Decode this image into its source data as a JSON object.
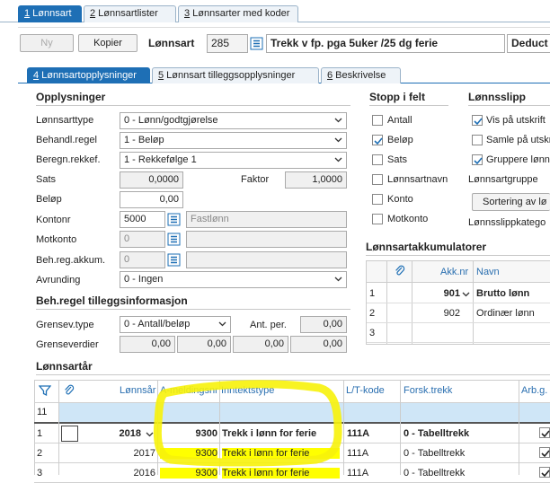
{
  "top_tabs": [
    {
      "key": "1",
      "rest": " Lønnsart",
      "active": true
    },
    {
      "key": "2",
      "rest": " Lønnsartlister",
      "active": false
    },
    {
      "key": "3",
      "rest": " Lønnsarter med koder",
      "active": false
    }
  ],
  "toolbar": {
    "new_label": "Ny",
    "copy_label": "Kopier",
    "wage_type_label": "Lønnsart",
    "wage_type_number": "285",
    "wage_type_name": "Trekk v fp. pga 5uker /25 dg ferie",
    "deduct_label": "Deduct"
  },
  "sub_tabs": [
    {
      "key": "4",
      "rest": " Lønnsartopplysninger",
      "active": true
    },
    {
      "key": "5",
      "rest": " Lønnsart tilleggsopplysninger",
      "active": false
    },
    {
      "key": "6",
      "rest": " Beskrivelse",
      "active": false
    }
  ],
  "info": {
    "heading": "Opplysninger",
    "type_label": "Lønnsarttype",
    "type_value": "0 - Lønn/godtgjørelse",
    "rule_label": "Behandl.regel",
    "rule_value": "1 - Beløp",
    "calc_label": "Beregn.rekkef.",
    "calc_value": "1 - Rekkefølge 1",
    "rate_label": "Sats",
    "rate_value": "0,0000",
    "factor_label": "Faktor",
    "factor_value": "1,0000",
    "amount_label": "Beløp",
    "amount_value": "0,00",
    "account_label": "Kontonr",
    "account_value": "5000",
    "account_name": "Fastlønn",
    "counter_label": "Motkonto",
    "counter_value": "0",
    "accum_label": "Beh.reg.akkum.",
    "accum_value": "0",
    "round_label": "Avrunding",
    "round_value": "0 - Ingen"
  },
  "rule_extra": {
    "heading": "Beh.regel tilleggsinformasjon",
    "limit_type_label": "Grensev.type",
    "limit_type_value": "0 - Antall/beløp",
    "pct_label": "Ant. per.",
    "pct_value": "0,00",
    "limit_values_label": "Grenseverdier",
    "limit_v1": "0,00",
    "limit_v2": "0,00",
    "limit_v3": "0,00",
    "limit_v4": "0,00"
  },
  "stop": {
    "heading": "Stopp i felt",
    "items": [
      {
        "label": "Antall",
        "checked": false
      },
      {
        "label": "Beløp",
        "checked": true
      },
      {
        "label": "Sats",
        "checked": false
      },
      {
        "label": "Lønnsartnavn",
        "checked": false
      },
      {
        "label": "Konto",
        "checked": false
      },
      {
        "label": "Motkonto",
        "checked": false
      }
    ]
  },
  "payslip": {
    "heading": "Lønnsslipp",
    "show_label": "Vis på utskrift",
    "show_checked": true,
    "collect_label": "Samle på utskr",
    "collect_checked": false,
    "group_label": "Gruppere lønns",
    "group_checked": true,
    "group_name_label": "Lønnsartgruppe",
    "sort_button": "Sortering av lø",
    "category_label": "Lønnsslippkatego"
  },
  "accumulators": {
    "heading": "Lønnsartakkumulatorer",
    "col_akk": "Akk.nr",
    "col_name": "Navn",
    "rows": [
      {
        "n": "1",
        "akk": "901",
        "name": "Brutto lønn"
      },
      {
        "n": "2",
        "akk": "902",
        "name": "Ordinær lønn"
      },
      {
        "n": "3",
        "akk": "",
        "name": ""
      }
    ]
  },
  "years": {
    "heading": "Lønnsartår",
    "cols": {
      "year": "Lønnsår",
      "amelding": "A-meldingsnr",
      "income": "Inntektstype",
      "lt": "L/T-kode",
      "forsk": "Forsk.trekk",
      "arb": "Arb.g."
    },
    "count": "11",
    "rows": [
      {
        "n": "1",
        "year": "2018",
        "amelding": "9300",
        "income": "Trekk i lønn for ferie",
        "lt": "111A",
        "forsk": "0 - Tabelltrekk"
      },
      {
        "n": "2",
        "year": "2017",
        "amelding": "9300",
        "income": "Trekk i lønn for ferie",
        "lt": "111A",
        "forsk": "0 - Tabelltrekk"
      },
      {
        "n": "3",
        "year": "2016",
        "amelding": "9300",
        "income": "Trekk i lønn for ferie",
        "lt": "111A",
        "forsk": "0 - Tabelltrekk"
      }
    ]
  },
  "colors": {
    "accent": "#1e6fb5",
    "highlight": "#ffff00",
    "header_blue": "#2a6fb0",
    "selected_row": "#cfe6f7"
  }
}
